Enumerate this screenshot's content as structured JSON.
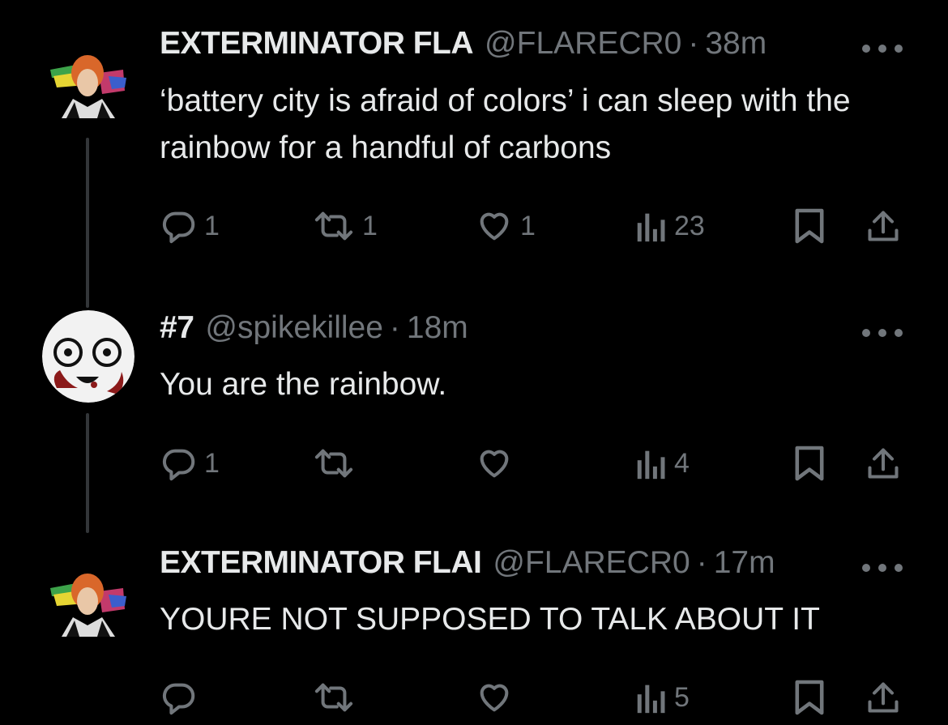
{
  "tweets": [
    {
      "name": "EXTERMINATOR FLA",
      "handle": "@FLARECR0",
      "dot": "·",
      "time": "38m",
      "text": "‘battery city is afraid of colors’ i can sleep with the rainbow for a handful of carbons",
      "replies": "1",
      "retweets": "1",
      "likes": "1",
      "views": "23"
    },
    {
      "name": "#7",
      "handle": "@spikekillee",
      "dot": "·",
      "time": "18m",
      "text": "You are the rainbow.",
      "replies": "1",
      "retweets": "",
      "likes": "",
      "views": "4"
    },
    {
      "name": "EXTERMINATOR FLAI",
      "handle": "@FLARECR0",
      "dot": "·",
      "time": "17m",
      "text": "YOURE NOT SUPPOSED TO TALK ABOUT IT",
      "replies": "",
      "retweets": "",
      "likes": "",
      "views": "5"
    }
  ],
  "icons": {
    "reply": "reply-icon",
    "retweet": "retweet-icon",
    "like": "heart-icon",
    "views": "views-icon",
    "bookmark": "bookmark-icon",
    "share": "share-icon",
    "more": "more-icon"
  },
  "colors": {
    "background": "#000000",
    "text": "#e7e9ea",
    "secondary": "#71767b",
    "thread_line": "#333639"
  }
}
